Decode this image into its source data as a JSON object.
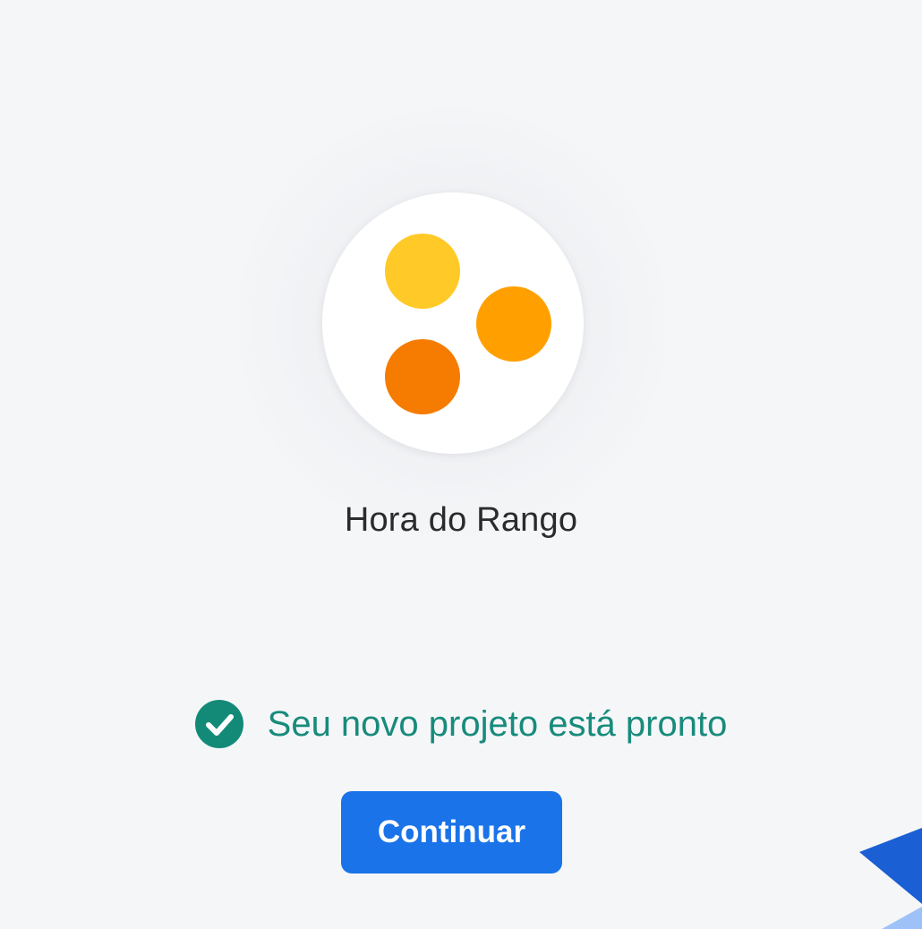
{
  "project": {
    "name": "Hora do Rango",
    "logo": {
      "icon": "three-dots-logo-icon",
      "dot_colors": [
        "#ffca28",
        "#ffa000",
        "#f57c00"
      ]
    }
  },
  "status": {
    "icon": "check-circle-icon",
    "icon_color": "#138a78",
    "text": "Seu novo projeto está pronto",
    "text_color": "#188b7c"
  },
  "actions": {
    "continue_label": "Continuar",
    "continue_color": "#1a73e8"
  },
  "decoration": {
    "corner_icon": "blue-corner-shape",
    "colors": [
      "#1a5fd3",
      "#9ec2f7"
    ]
  }
}
